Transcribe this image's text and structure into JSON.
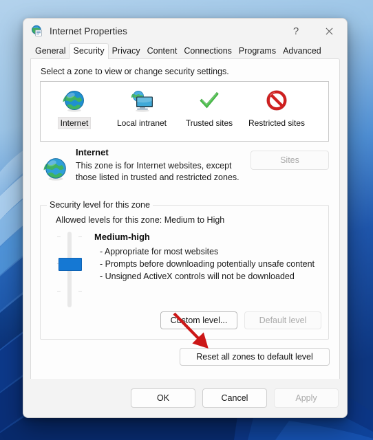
{
  "window": {
    "title": "Internet Properties",
    "icon": "internet-properties-icon",
    "help_label": "?",
    "close_label": "✕"
  },
  "tabs": [
    {
      "label": "General",
      "active": false
    },
    {
      "label": "Security",
      "active": true
    },
    {
      "label": "Privacy",
      "active": false
    },
    {
      "label": "Content",
      "active": false
    },
    {
      "label": "Connections",
      "active": false
    },
    {
      "label": "Programs",
      "active": false
    },
    {
      "label": "Advanced",
      "active": false
    }
  ],
  "security_tab": {
    "intro": "Select a zone to view or change security settings.",
    "zones": [
      {
        "label": "Internet",
        "icon": "globe-icon",
        "selected": true
      },
      {
        "label": "Local intranet",
        "icon": "intranet-monitor-icon",
        "selected": false
      },
      {
        "label": "Trusted sites",
        "icon": "green-check-icon",
        "selected": false
      },
      {
        "label": "Restricted sites",
        "icon": "red-prohibition-icon",
        "selected": false
      }
    ],
    "zone_description": {
      "title": "Internet",
      "body": "This zone is for Internet websites, except those listed in trusted and restricted zones.",
      "icon": "globe-icon",
      "sites_button": {
        "label": "Sites",
        "enabled": false
      }
    },
    "security_level": {
      "legend": "Security level for this zone",
      "allowed_levels": "Allowed levels for this zone: Medium to High",
      "level_name": "Medium-high",
      "bullets": [
        "- Appropriate for most websites",
        "- Prompts before downloading potentially unsafe content",
        "- Unsigned ActiveX controls will not be downloaded"
      ],
      "slider_value_label": "Medium-high",
      "custom_level_button": {
        "label": "Custom level...",
        "enabled": true
      },
      "default_level_button": {
        "label": "Default level",
        "enabled": false
      }
    },
    "reset_button": {
      "label": "Reset all zones to default level",
      "enabled": true
    }
  },
  "footer": {
    "ok": {
      "label": "OK",
      "enabled": true
    },
    "cancel": {
      "label": "Cancel",
      "enabled": true
    },
    "apply": {
      "label": "Apply",
      "enabled": false
    }
  },
  "annotation": {
    "type": "arrow",
    "color": "#cc1717",
    "points_to": "Custom level..."
  },
  "colors": {
    "accent_blue": "#1578d3",
    "annotation_red": "#cc1717",
    "window_bg": "#f3f3f3",
    "page_bg": "#fdfdfd",
    "disabled_text": "#a9a9a9"
  }
}
